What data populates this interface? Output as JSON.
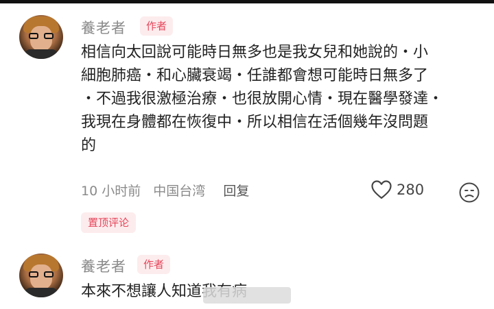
{
  "comments": [
    {
      "username": "養老者",
      "badge": "作者",
      "lines": [
        "相信向太回說可能時日無多也是我女兒和她說的・小",
        "細胞肺癌・和心臟衰竭・任誰都會想可能時日無多了",
        "・不過我很激極治療・也很放開心情・現在醫學發達・",
        "我現在身體都在恢復中・所以相信在活個幾年沒問題",
        "的"
      ],
      "time": "10 小时前",
      "location": "中国台湾",
      "reply_label": "回复",
      "likes": "280",
      "pinned_label": "置顶评论"
    },
    {
      "username": "養老者",
      "badge": "作者",
      "lines": [
        "本來不想讓人知道我有病"
      ]
    }
  ],
  "icons": {
    "like": "heart-outline-icon",
    "dislike": "frown-face-icon"
  },
  "colors": {
    "accent": "#e5465b",
    "badge_bg": "#fdeced",
    "muted": "#8a8a8a"
  }
}
